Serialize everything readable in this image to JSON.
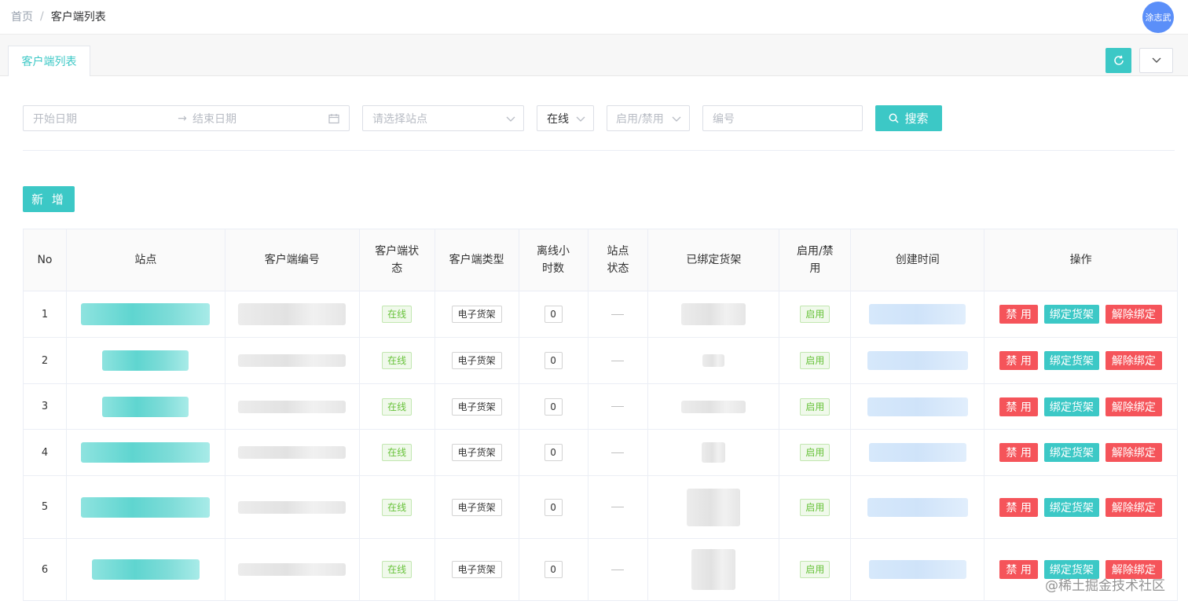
{
  "breadcrumb": {
    "home": "首页",
    "separator": "/",
    "current": "客户端列表"
  },
  "user": {
    "name": "涂志武"
  },
  "tabs": [
    {
      "label": "客户端列表"
    }
  ],
  "filters": {
    "start_placeholder": "开始日期",
    "end_placeholder": "结束日期",
    "site_placeholder": "请选择站点",
    "online_value": "在线",
    "enable_placeholder": "启用/禁用",
    "code_placeholder": "编号",
    "search_label": "搜索"
  },
  "add_label": "新 增",
  "columns": [
    "No",
    "站点",
    "客户端编号",
    "客户端状态",
    "客户端类型",
    "离线小时数",
    "站点状态",
    "已绑定货架",
    "启用/禁用",
    "创建时间",
    "操作"
  ],
  "rows": [
    {
      "no": "1",
      "status": "在线",
      "type": "电子货架",
      "offline": "0",
      "enabled": "启用"
    },
    {
      "no": "2",
      "status": "在线",
      "type": "电子货架",
      "offline": "0",
      "enabled": "启用"
    },
    {
      "no": "3",
      "status": "在线",
      "type": "电子货架",
      "offline": "0",
      "enabled": "启用"
    },
    {
      "no": "4",
      "status": "在线",
      "type": "电子货架",
      "offline": "0",
      "enabled": "启用"
    },
    {
      "no": "5",
      "status": "在线",
      "type": "电子货架",
      "offline": "0",
      "enabled": "启用"
    },
    {
      "no": "6",
      "status": "在线",
      "type": "电子货架",
      "offline": "0",
      "enabled": "启用"
    }
  ],
  "actions": {
    "disable": "禁 用",
    "bind": "绑定货架",
    "unbind": "解除绑定"
  },
  "watermark": "@稀土掘金技术社区",
  "colors": {
    "accent": "#3cc8c6",
    "danger": "#f5545a",
    "success": "#67c23a"
  }
}
